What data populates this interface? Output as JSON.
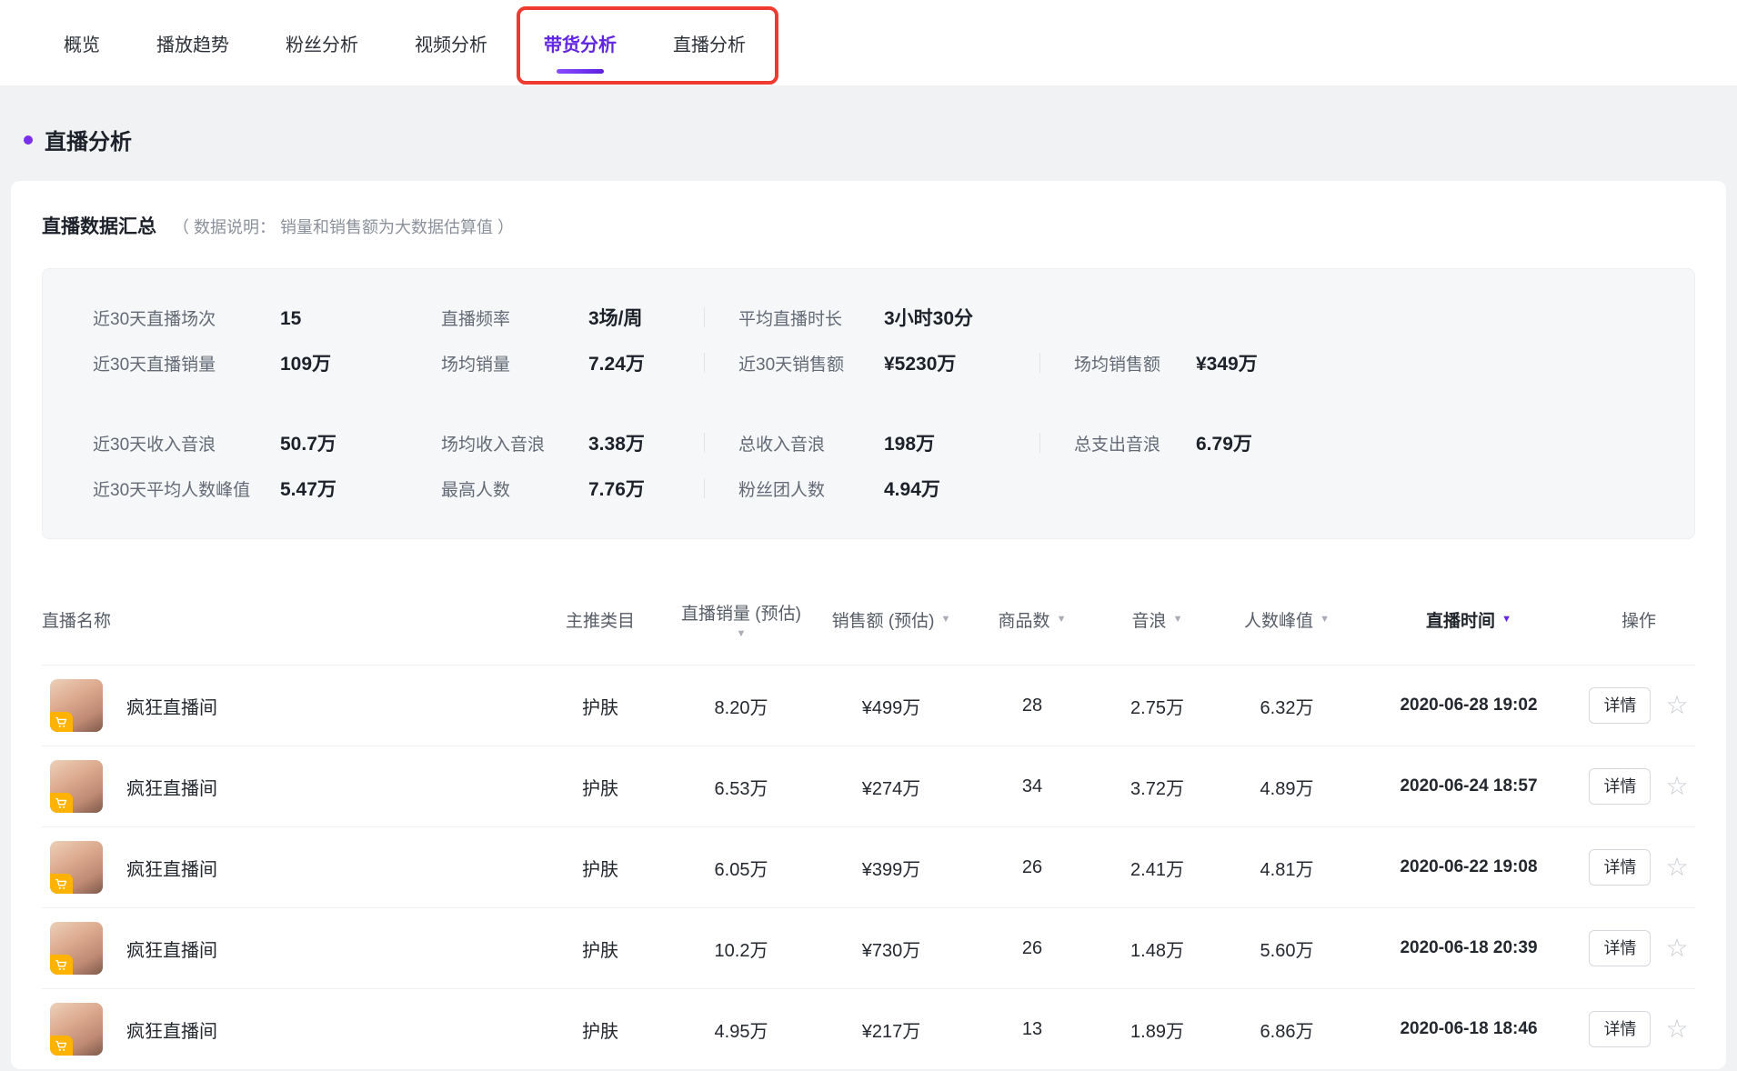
{
  "colors": {
    "accent_purple": "#6226e3",
    "annotation_red": "#ef3a30",
    "cart_badge_orange": "#ffb200"
  },
  "tabbar": {
    "tabs": [
      {
        "key": "overview",
        "label": "概览"
      },
      {
        "key": "play-trend",
        "label": "播放趋势"
      },
      {
        "key": "fans-analysis",
        "label": "粉丝分析"
      },
      {
        "key": "video-analysis",
        "label": "视频分析"
      },
      {
        "key": "sales-analysis",
        "label": "带货分析"
      },
      {
        "key": "live-analysis",
        "label": "直播分析"
      }
    ],
    "active_index": 4,
    "annotation_span": [
      4,
      5
    ]
  },
  "section": {
    "title": "直播分析"
  },
  "summary": {
    "title": "直播数据汇总",
    "note": "（ 数据说明： 销量和销售额为大数据估算值 ）",
    "stats_rows": [
      [
        {
          "label": "近30天直播场次",
          "value": "15"
        },
        {
          "label": "直播频率",
          "value": "3场/周"
        },
        {
          "label": "平均直播时长",
          "value": "3小时30分"
        },
        null
      ],
      [
        {
          "label": "近30天直播销量",
          "value": "109万"
        },
        {
          "label": "场均销量",
          "value": "7.24万"
        },
        {
          "label": "近30天销售额",
          "value": "¥5230万"
        },
        {
          "label": "场均销售额",
          "value": "¥349万"
        }
      ],
      [
        {
          "label": "近30天收入音浪",
          "value": "50.7万"
        },
        {
          "label": "场均收入音浪",
          "value": "3.38万"
        },
        {
          "label": "总收入音浪",
          "value": "198万"
        },
        {
          "label": "总支出音浪",
          "value": "6.79万"
        }
      ],
      [
        {
          "label": "近30天平均人数峰值",
          "value": "5.47万"
        },
        {
          "label": "最高人数",
          "value": "7.76万"
        },
        {
          "label": "粉丝团人数",
          "value": "4.94万"
        },
        null
      ]
    ]
  },
  "table": {
    "columns": [
      {
        "key": "name",
        "label": "直播名称",
        "sortable": false
      },
      {
        "key": "category",
        "label": "主推类目",
        "sortable": false
      },
      {
        "key": "sales_volume",
        "label": "直播销量 (预估)",
        "sortable": true,
        "caret_position": "below"
      },
      {
        "key": "sales_amount",
        "label": "销售额 (预估)",
        "sortable": true
      },
      {
        "key": "product_count",
        "label": "商品数",
        "sortable": true
      },
      {
        "key": "sound_wave",
        "label": "音浪",
        "sortable": true
      },
      {
        "key": "peak_viewers",
        "label": "人数峰值",
        "sortable": true
      },
      {
        "key": "live_time",
        "label": "直播时间",
        "sortable": true,
        "sorted": true
      },
      {
        "key": "actions",
        "label": "操作",
        "sortable": false
      }
    ],
    "detail_label": "详情",
    "rows": [
      {
        "name": "疯狂直播间",
        "category": "护肤",
        "sales_volume": "8.20万",
        "sales_amount": "¥499万",
        "product_count": "28",
        "sound_wave": "2.75万",
        "peak_viewers": "6.32万",
        "live_time": "2020-06-28 19:02"
      },
      {
        "name": "疯狂直播间",
        "category": "护肤",
        "sales_volume": "6.53万",
        "sales_amount": "¥274万",
        "product_count": "34",
        "sound_wave": "3.72万",
        "peak_viewers": "4.89万",
        "live_time": "2020-06-24 18:57"
      },
      {
        "name": "疯狂直播间",
        "category": "护肤",
        "sales_volume": "6.05万",
        "sales_amount": "¥399万",
        "product_count": "26",
        "sound_wave": "2.41万",
        "peak_viewers": "4.81万",
        "live_time": "2020-06-22 19:08"
      },
      {
        "name": "疯狂直播间",
        "category": "护肤",
        "sales_volume": "10.2万",
        "sales_amount": "¥730万",
        "product_count": "26",
        "sound_wave": "1.48万",
        "peak_viewers": "5.60万",
        "live_time": "2020-06-18 20:39"
      },
      {
        "name": "疯狂直播间",
        "category": "护肤",
        "sales_volume": "4.95万",
        "sales_amount": "¥217万",
        "product_count": "13",
        "sound_wave": "1.89万",
        "peak_viewers": "6.86万",
        "live_time": "2020-06-18 18:46"
      }
    ]
  }
}
